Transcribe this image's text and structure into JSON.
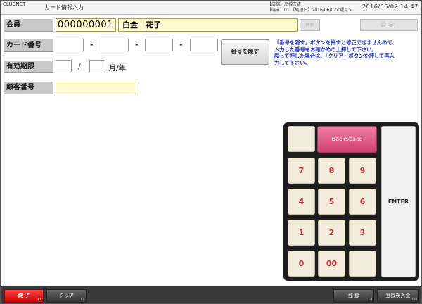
{
  "titlebar": {
    "app_name": "CLUBNET",
    "screen_title": "カード情報入力",
    "store_line1": "【店舗】高槻市店",
    "store_line2": "【端末】01 【処理日】2016/06/02<曜月>",
    "datetime": "2016/06/02 14:47"
  },
  "member": {
    "label": "会員",
    "number": "000000001",
    "name": "白金　花子",
    "search_label": "検索",
    "settings_label": "設定"
  },
  "card": {
    "label": "カード番号",
    "separator": "-",
    "hide_button": "番号を隠す",
    "info": "「番号を隠す」ボタンを押すと修正できませんので、\n入力した番号をお確かめの上押して下さい。\n誤って押した場合は、「クリア」ボタンを押して再入\n力して下さい。"
  },
  "expiry": {
    "label": "有効期限",
    "slash": "/",
    "suffix": "月/年"
  },
  "customer": {
    "label": "顧客番号"
  },
  "keypad": {
    "backspace": "BackSpace",
    "enter": "ENTER",
    "rows": [
      [
        "7",
        "8",
        "9"
      ],
      [
        "4",
        "5",
        "6"
      ],
      [
        "1",
        "2",
        "3"
      ],
      [
        "0",
        "00",
        ""
      ]
    ]
  },
  "footer": {
    "end_label": "終 了",
    "end_key": "F1",
    "clear_label": "クリア",
    "clear_key": "F2",
    "register_label": "登 録",
    "register_key": "F9",
    "register_deposit_label": "登録後入金",
    "register_deposit_key": "F10"
  },
  "colors": {
    "accent_red": "#cc0000",
    "info_blue": "#1a31d6",
    "input_yellow": "#fffbd0",
    "backspace_pink": "#d0406e"
  }
}
